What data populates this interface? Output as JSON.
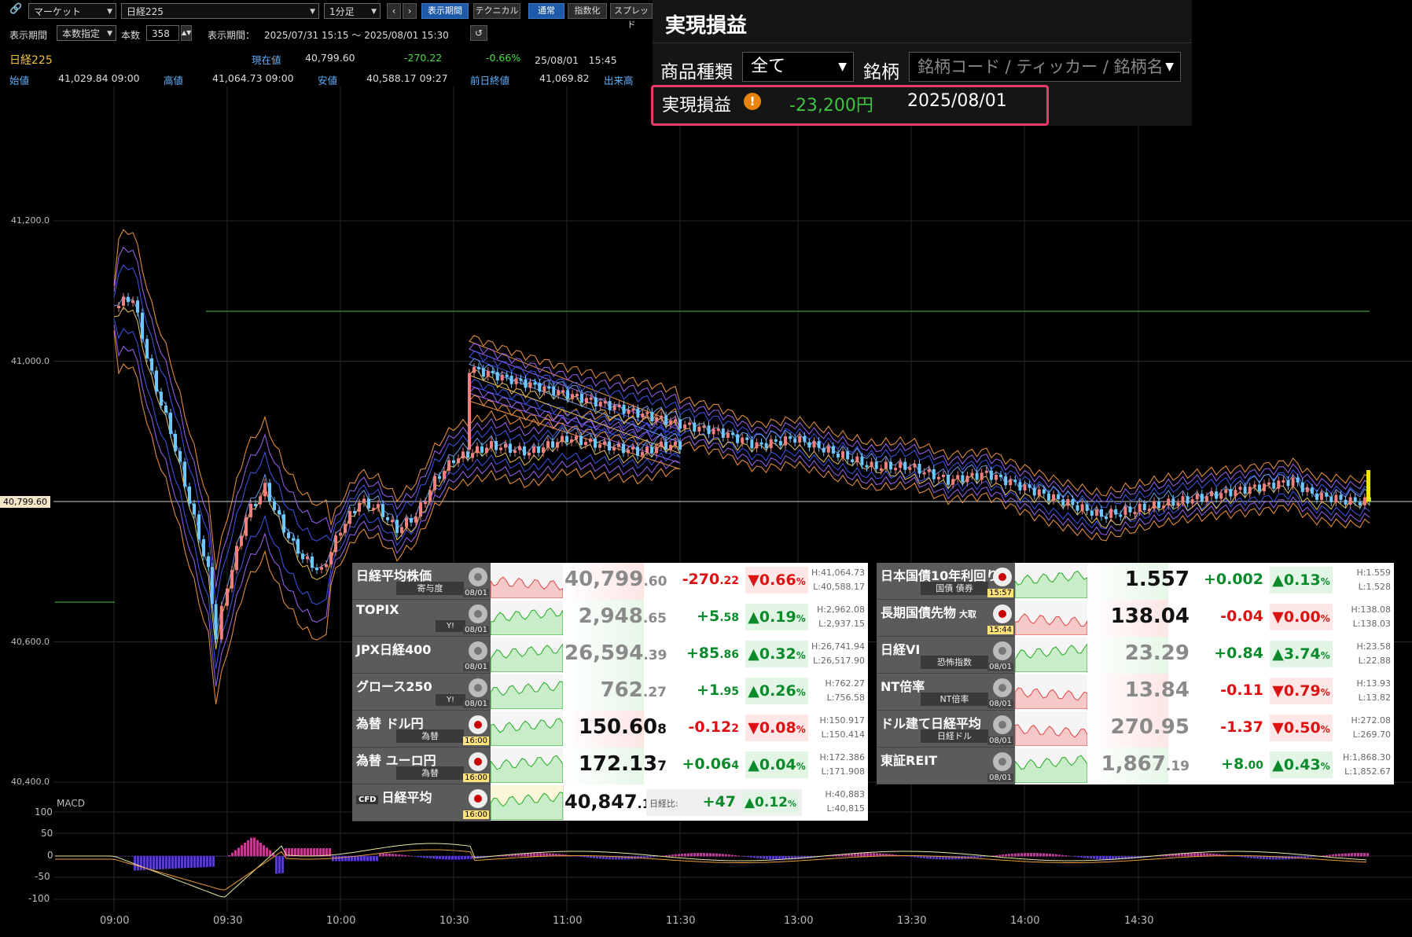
{
  "toolbar": {
    "market_select": "マーケット",
    "symbol_select": "日経225",
    "interval_select": "1分足",
    "prev_arrow": "‹",
    "next_arrow": "›",
    "btn_display_period": "表示期間",
    "btn_technical": "テクニカル",
    "btn_normal": "通常",
    "btn_index": "指数化",
    "btn_spread": "スプレッド",
    "period_label": "表示期間",
    "period_mode": "本数指定",
    "count_label": "本数",
    "count_value": "358",
    "period_range_label": "表示期間：",
    "period_range": "2025/07/31 15:15 ～ 2025/08/01 15:30"
  },
  "quote": {
    "name": "日経225",
    "current_label": "現在値",
    "current": "40,799.60",
    "change": "-270.22",
    "change_pct": "-0.66%",
    "datetime": "25/08/01　15:45",
    "open_label": "始値",
    "open": "41,029.84 09:00",
    "high_label": "高値",
    "high": "41,064.73 09:00",
    "low_label": "安値",
    "low": "40,588.17 09:27",
    "prev_label": "前日終値",
    "prev": "41,069.82",
    "volume_label": "出来高"
  },
  "pnl_panel": {
    "title": "実現損益",
    "product_type_label": "商品種類",
    "product_type_value": "全て",
    "symbol_label": "銘柄",
    "symbol_placeholder": "銘柄コード / ティッカー / 銘柄名",
    "result_label": "実現損益",
    "result_value": "-23,200円",
    "result_date": "2025/08/01",
    "highlight_color": "#e83a6a"
  },
  "chart": {
    "current_price_label": "40,799.60",
    "y_ticks": [
      "41,200.0",
      "41,000.0",
      "40,600.0",
      "40,400.0"
    ],
    "x_ticks": [
      "09:00",
      "09:30",
      "10:00",
      "10:30",
      "11:00",
      "11:30",
      "13:00",
      "13:30",
      "14:00",
      "14:30"
    ],
    "macd_label": "MACD",
    "macd_ticks": [
      "100",
      "50",
      "0",
      "-50",
      "-100"
    ]
  },
  "chart_data": {
    "type": "line",
    "title": "",
    "series": [
      {
        "name": "",
        "x": [
          "09:00",
          "09:05",
          "09:10",
          "09:15",
          "09:20",
          "09:25",
          "09:27",
          "09:30",
          "09:35",
          "09:40",
          "09:45",
          "09:50",
          "09:55",
          "10:00",
          "10:05",
          "10:10",
          "10:15",
          "10:20",
          "10:25",
          "10:30",
          "10:40",
          "10:50",
          "11:00",
          "11:10",
          "11:20",
          "11:25",
          "11:30",
          "11:35",
          "12:30",
          "12:40",
          "12:50",
          "13:00",
          "13:10",
          "13:20",
          "13:30",
          "13:40",
          "13:50",
          "14:00",
          "14:10",
          "14:20",
          "14:30",
          "14:40",
          "14:50",
          "15:00",
          "15:10",
          "15:15",
          "15:25",
          "15:30"
        ],
        "values": [
          41080,
          41090,
          40980,
          40900,
          40800,
          40700,
          40610,
          40680,
          40780,
          40820,
          40760,
          40720,
          40700,
          40760,
          40800,
          40790,
          40760,
          40780,
          40830,
          40860,
          40880,
          40870,
          40890,
          40880,
          40870,
          40880,
          40880,
          40990,
          40910,
          40900,
          40880,
          40890,
          40870,
          40850,
          40850,
          40830,
          40840,
          40820,
          40800,
          40780,
          40790,
          40800,
          40810,
          40820,
          40830,
          40810,
          40800,
          40799.6
        ]
      }
    ],
    "ylim": [
      40400,
      41300
    ],
    "colors": {
      "candle_up": "#f08080",
      "candle_down": "#6cc8ff",
      "bollinger": [
        "#f0a040",
        "#8860e0",
        "#3a50d8"
      ],
      "reference_line": "#3a9a3a"
    }
  },
  "market_left": [
    {
      "name": "日経平均株価",
      "sub": "寄与度",
      "date": "08/01",
      "price_main": "40,799",
      "price_dec": ".60",
      "price_style": "mute",
      "change_main": "-270",
      "change_dec": ".22",
      "dir": "neg",
      "pct": "0.66",
      "high": "H:41,064.73",
      "low": "L:40,588.17",
      "spark": "neg"
    },
    {
      "name": "TOPIX",
      "badge": "Y!",
      "date": "08/01",
      "price_main": "2,948",
      "price_dec": ".65",
      "price_style": "mute",
      "change_main": "+5",
      "change_dec": ".58",
      "dir": "pos",
      "pct": "0.19",
      "high": "H:2,962.08",
      "low": "L:2,937.15",
      "spark": "pos"
    },
    {
      "name": "JPX日経400",
      "date": "08/01",
      "price_main": "26,594",
      "price_dec": ".39",
      "price_style": "mute",
      "change_main": "+85",
      "change_dec": ".86",
      "dir": "pos",
      "pct": "0.32",
      "high": "H:26,741.94",
      "low": "L:26,517.90",
      "spark": "pos"
    },
    {
      "name": "グロース250",
      "badge": "Y!",
      "date": "08/01",
      "price_main": "762",
      "price_dec": ".27",
      "price_style": "mute",
      "change_main": "+1",
      "change_dec": ".95",
      "dir": "pos",
      "pct": "0.26",
      "high": "H:762.27",
      "low": "L:756.58",
      "spark": "pos"
    },
    {
      "name": "為替 ドル円",
      "sub": "為替",
      "date": "16:00",
      "date_style": "y",
      "price_main": "150.60",
      "price_dec": "8",
      "price_style": "big",
      "change_main": "-0.12",
      "change_dec": "2",
      "dir": "neg",
      "pct": "0.08",
      "high": "H:150.917",
      "low": "L:150.414",
      "spark": "pos"
    },
    {
      "name": "為替 ユーロ円",
      "sub": "為替",
      "date": "16:00",
      "date_style": "y",
      "price_main": "172.13",
      "price_dec": "7",
      "price_style": "big",
      "change_main": "+0.06",
      "change_dec": "4",
      "dir": "pos",
      "pct": "0.04",
      "high": "H:172.386",
      "low": "L:171.908",
      "spark": "pos"
    }
  ],
  "cfd_row": {
    "prefix": "CFD",
    "name": "日経平均",
    "date": "16:00",
    "price_main": "40,847",
    "price_dec": ".10",
    "label": "日経比:",
    "change": "+47",
    "pct": "0.12",
    "high": "H:40,883",
    "low": "L:40,815"
  },
  "market_right": [
    {
      "name": "日本国債10年利回り",
      "sub": "国債 債券",
      "date": "15:57",
      "date_style": "y",
      "price_main": "1.557",
      "price_dec": "",
      "price_style": "big",
      "change_main": "+0.002",
      "change_dec": "",
      "dir": "pos",
      "pct": "0.13",
      "high": "H:1.559",
      "low": "L:1.528",
      "spark": "pos"
    },
    {
      "name": "長期国債先物",
      "suffix": "大取",
      "date": "15:44",
      "date_style": "y",
      "price_main": "138.04",
      "price_dec": "",
      "price_style": "big",
      "change_main": "-0.04",
      "change_dec": "",
      "dir": "neg",
      "pct": "0.00",
      "high": "H:138.08",
      "low": "L:138.03",
      "spark": "neg"
    },
    {
      "name": "日経VI",
      "sub": "恐怖指数",
      "date": "08/01",
      "price_main": "23.29",
      "price_dec": "",
      "price_style": "mute",
      "change_main": "+0.84",
      "change_dec": "",
      "dir": "pos",
      "pct": "3.74",
      "high": "H:23.58",
      "low": "L:22.88",
      "spark": "pos"
    },
    {
      "name": "NT倍率",
      "sub": "NT倍率",
      "date": "08/01",
      "price_main": "13.84",
      "price_dec": "",
      "price_style": "mute",
      "change_main": "-0.11",
      "change_dec": "",
      "dir": "neg",
      "pct": "0.79",
      "high": "H:13.93",
      "low": "L:13.82",
      "spark": "neg"
    },
    {
      "name": "ドル建て日経平均",
      "sub": "日経ドル",
      "date": "08/01",
      "price_main": "270.95",
      "price_dec": "",
      "price_style": "mute",
      "change_main": "-1.37",
      "change_dec": "",
      "dir": "neg",
      "pct": "0.50",
      "high": "H:272.08",
      "low": "L:269.70",
      "spark": "neg"
    },
    {
      "name": "東証REIT",
      "date": "08/01",
      "price_main": "1,867",
      "price_dec": ".19",
      "price_style": "mute",
      "change_main": "+8",
      "change_dec": ".00",
      "dir": "pos",
      "pct": "0.43",
      "high": "H:1,868.30",
      "low": "L:1,852.67",
      "spark": "pos"
    }
  ]
}
